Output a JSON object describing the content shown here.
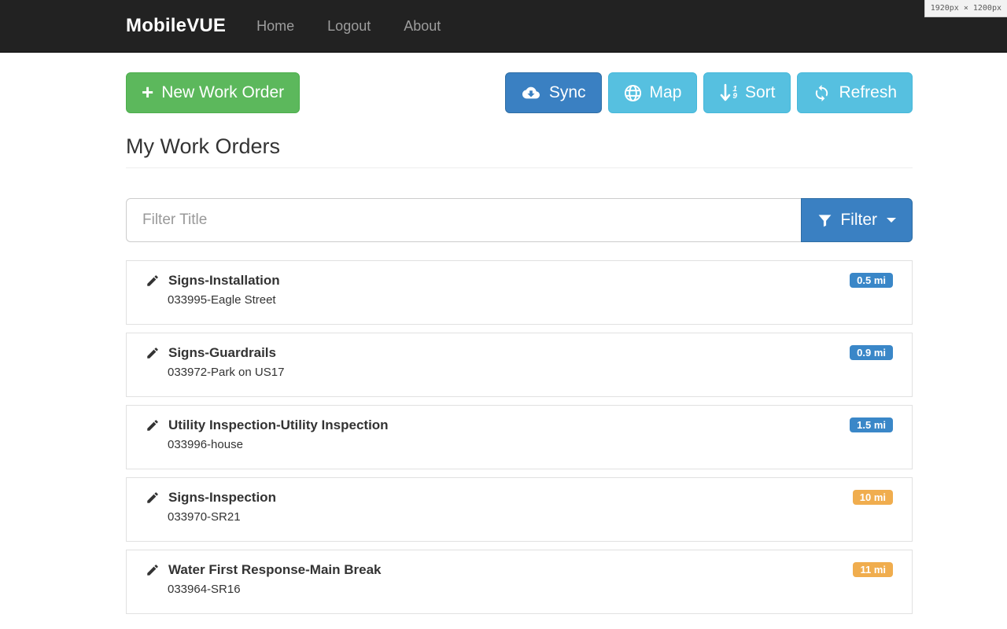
{
  "viewport_indicator": "1920px × 1200px",
  "navbar": {
    "brand": "MobileVUE",
    "links": [
      {
        "label": "Home"
      },
      {
        "label": "Logout"
      },
      {
        "label": "About"
      }
    ]
  },
  "toolbar": {
    "new_work_order_label": "New Work Order",
    "sync_label": "Sync",
    "map_label": "Map",
    "sort_label": "Sort",
    "refresh_label": "Refresh",
    "sort_digit_top": "1",
    "sort_digit_bottom": "9"
  },
  "page": {
    "title": "My Work Orders"
  },
  "filter": {
    "placeholder": "Filter Title",
    "button_label": "Filter"
  },
  "work_orders": [
    {
      "title": "Signs-Installation",
      "subtitle": "033995-Eagle Street",
      "distance": "0.5 mi",
      "badge_color": "#3a87c8"
    },
    {
      "title": "Signs-Guardrails",
      "subtitle": "033972-Park on US17",
      "distance": "0.9 mi",
      "badge_color": "#3a87c8"
    },
    {
      "title": "Utility Inspection-Utility Inspection",
      "subtitle": "033996-house",
      "distance": "1.5 mi",
      "badge_color": "#3a87c8"
    },
    {
      "title": "Signs-Inspection",
      "subtitle": "033970-SR21",
      "distance": "10 mi",
      "badge_color": "#f0ad4e"
    },
    {
      "title": "Water First Response-Main Break",
      "subtitle": "033964-SR16",
      "distance": "11 mi",
      "badge_color": "#f0ad4e"
    }
  ],
  "colors": {
    "navbar_bg": "#222222",
    "success_green": "#5cb85c",
    "primary_blue": "#3a80c2",
    "info_blue": "#56c0e0",
    "badge_blue": "#3a87c8",
    "badge_orange": "#f0ad4e"
  }
}
